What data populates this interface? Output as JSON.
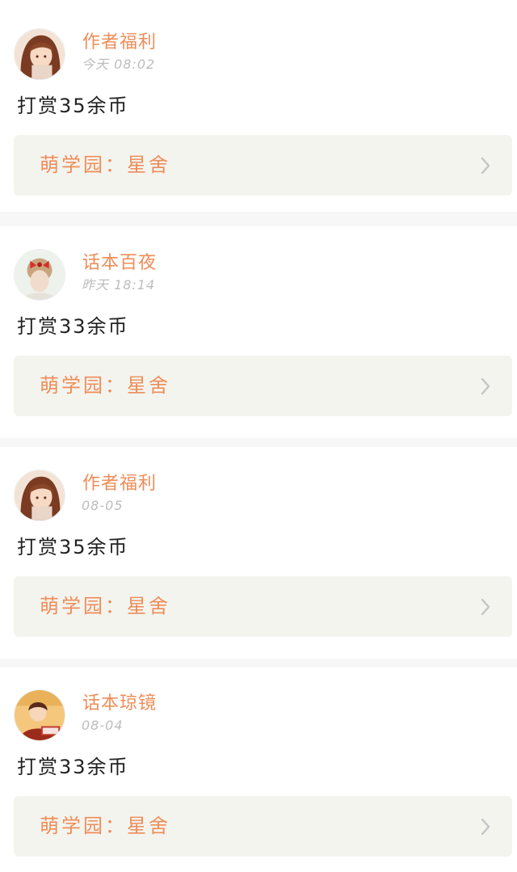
{
  "feed": {
    "items": [
      {
        "username": "作者福利",
        "time": "今天 08:02",
        "tip_text": "打赏35余币",
        "link_label": "萌学园：星舍",
        "avatar_icon": "anime-girl-avatar-icon"
      },
      {
        "username": "话本百夜",
        "time": "昨天 18:14",
        "tip_text": "打赏33余币",
        "link_label": "萌学园：星舍",
        "avatar_icon": "girl-red-bow-avatar-icon"
      },
      {
        "username": "作者福利",
        "time": "08-05",
        "tip_text": "打赏35余币",
        "link_label": "萌学园：星舍",
        "avatar_icon": "anime-girl-avatar-icon"
      },
      {
        "username": "话本琼镜",
        "time": "08-04",
        "tip_text": "打赏33余币",
        "link_label": "萌学园：星舍",
        "avatar_icon": "character-badge-avatar-icon"
      }
    ]
  },
  "colors": {
    "accent": "#ee8d58",
    "muted": "#bdbdbd",
    "link_bg": "#f4f4ef",
    "divider": "#f7f7f7"
  }
}
